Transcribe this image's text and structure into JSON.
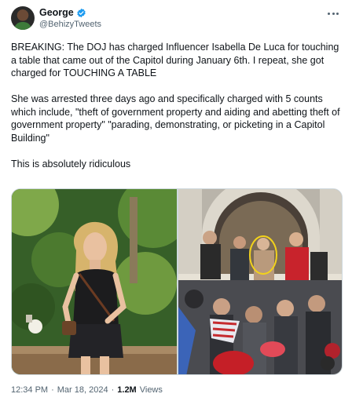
{
  "author": {
    "display_name": "George",
    "handle": "@BehizyTweets",
    "verified_color": "#1d9bf0"
  },
  "tweet": {
    "text": "BREAKING: The DOJ has charged Influencer Isabella De Luca for touching a table that came out of the Capitol during January 6th. I repeat, she got charged for TOUCHING A TABLE\n\nShe was arrested three days ago and specifically charged with 5 counts which include, \"theft of government property and aiding and abetting theft of government property\" \"parading, demonstrating, or picketing in a Capitol Building\"\n\nThis is absolutely ridiculous"
  },
  "media": {
    "left_photo": "photo-woman-in-garden",
    "right_photo": "photo-capitol-crowd",
    "highlight_color": "#f2d21b"
  },
  "meta": {
    "time": "12:34 PM",
    "separator_1": "·",
    "date": "Mar 18, 2024",
    "separator_2": "·",
    "views_count": "1.2M",
    "views_label": "Views"
  }
}
